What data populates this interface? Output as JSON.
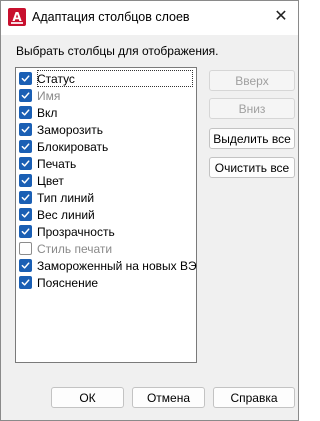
{
  "window": {
    "title": "Адаптация столбцов слоев",
    "app_icon": "autocad-icon",
    "close_glyph": "✕"
  },
  "caption": "Выбрать столбцы для отображения.",
  "columns": [
    {
      "label": "Статус",
      "checked": true,
      "disabled": false,
      "focused": true
    },
    {
      "label": "Имя",
      "checked": true,
      "disabled": true,
      "focused": false
    },
    {
      "label": "Вкл",
      "checked": true,
      "disabled": false,
      "focused": false
    },
    {
      "label": "Заморозить",
      "checked": true,
      "disabled": false,
      "focused": false
    },
    {
      "label": "Блокировать",
      "checked": true,
      "disabled": false,
      "focused": false
    },
    {
      "label": "Печать",
      "checked": true,
      "disabled": false,
      "focused": false
    },
    {
      "label": "Цвет",
      "checked": true,
      "disabled": false,
      "focused": false
    },
    {
      "label": "Тип линий",
      "checked": true,
      "disabled": false,
      "focused": false
    },
    {
      "label": "Вес линий",
      "checked": true,
      "disabled": false,
      "focused": false
    },
    {
      "label": "Прозрачность",
      "checked": true,
      "disabled": false,
      "focused": false
    },
    {
      "label": "Стиль печати",
      "checked": false,
      "disabled": true,
      "focused": false
    },
    {
      "label": "Замороженный на новых ВЭ",
      "checked": true,
      "disabled": false,
      "focused": false
    },
    {
      "label": "Пояснение",
      "checked": true,
      "disabled": false,
      "focused": false
    }
  ],
  "side_buttons": {
    "up": {
      "label": "Вверх",
      "disabled": true
    },
    "down": {
      "label": "Вниз",
      "disabled": true
    },
    "select_all": {
      "label": "Выделить все",
      "disabled": false
    },
    "clear_all": {
      "label": "Очистить все",
      "disabled": false
    }
  },
  "footer": {
    "ok": "ОК",
    "cancel": "Отмена",
    "help": "Справка"
  },
  "colors": {
    "checkbox_on": "#1a5fb4",
    "app_icon": "#c8102e"
  }
}
